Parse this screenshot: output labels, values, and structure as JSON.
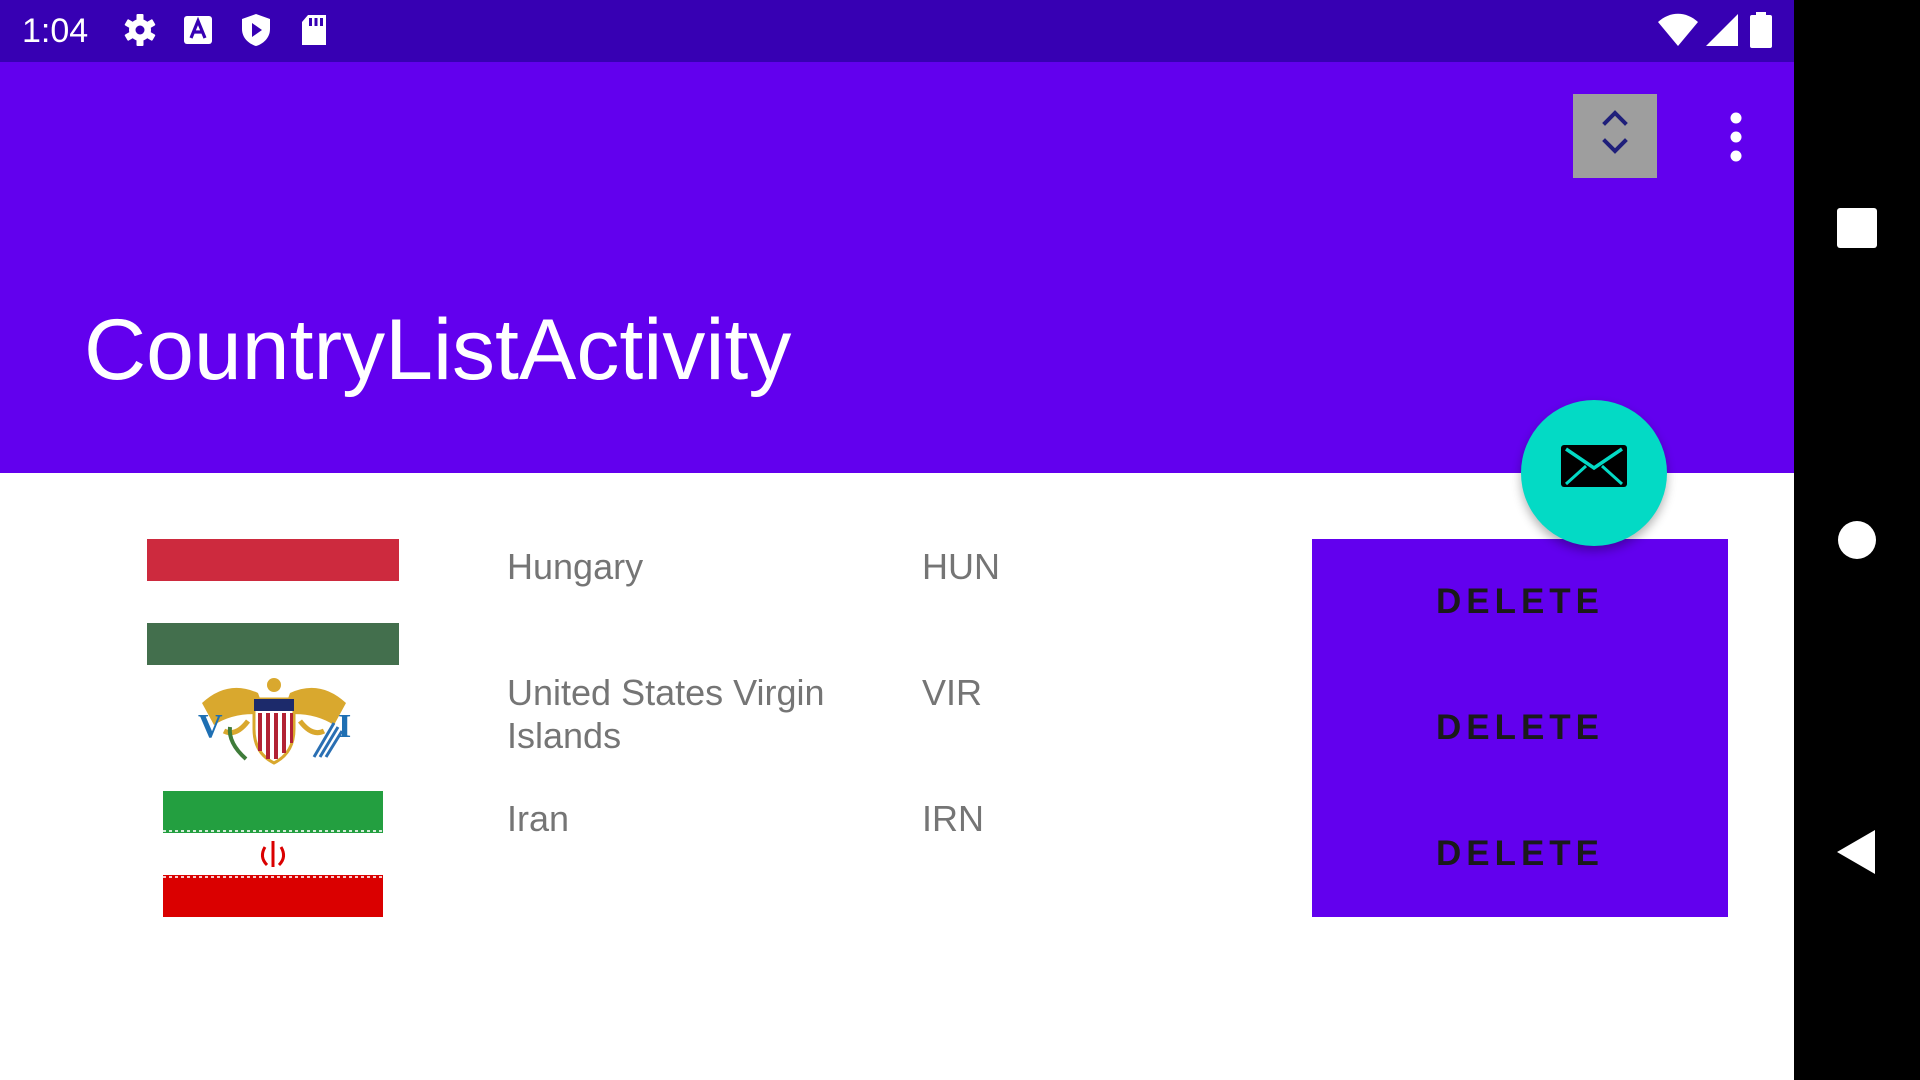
{
  "status_bar": {
    "time": "1:04",
    "icons": [
      "gear-icon",
      "a-text-icon",
      "play-shield-icon",
      "sd-card-icon"
    ],
    "right_icons": [
      "wifi-icon",
      "signal-icon",
      "battery-icon"
    ]
  },
  "app_bar": {
    "title": "CountryListActivity",
    "actions": [
      "sort-up-down-icon",
      "more-vert-icon"
    ]
  },
  "fab": {
    "icon": "email-icon",
    "color": "#03dac5"
  },
  "countries": [
    {
      "name": "Hungary",
      "code": "HUN",
      "flag": "hungary-flag",
      "action": "DELETE"
    },
    {
      "name": "United States Virgin Islands",
      "code": "VIR",
      "flag": "usvi-flag",
      "action": "DELETE"
    },
    {
      "name": "Iran",
      "code": "IRN",
      "flag": "iran-flag",
      "action": "DELETE"
    }
  ],
  "nav_bar": {
    "buttons": [
      "square-recents-icon",
      "circle-home-icon",
      "triangle-back-icon"
    ]
  },
  "colors": {
    "status_bar": "#3700b3",
    "primary": "#6200ee",
    "accent": "#03dac5"
  }
}
